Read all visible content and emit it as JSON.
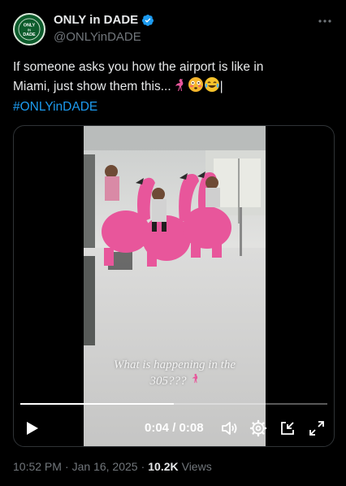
{
  "account": {
    "display_name": "ONLY in DADE",
    "handle": "@ONLYinDADE",
    "avatar_text_top": "ONLY",
    "avatar_text_mid": "IN",
    "avatar_text_bottom": "DADE",
    "verified": true
  },
  "tweet": {
    "text_line1": "If someone asks you how the airport is like in",
    "text_line2": "Miami, just show them this...",
    "text_tail": "|",
    "hashtag": "#ONLYinDADE",
    "emojis": [
      "flamingo-icon",
      "flushed-face-icon",
      "tears-of-joy-icon"
    ]
  },
  "video": {
    "caption_line1": "What is happening in the",
    "caption_line2": "305???",
    "current_time": "0:04",
    "separator": "/",
    "duration": "0:08",
    "progress": 0.5
  },
  "meta": {
    "time": "10:52 PM",
    "dot1": "·",
    "date": "Jan 16, 2025",
    "dot2": "·",
    "views_count": "10.2K",
    "views_label": "Views"
  },
  "colors": {
    "accent": "#1d9bf0",
    "text": "#e7e9ea",
    "muted": "#71767b",
    "flamingo": "#e8569b"
  }
}
